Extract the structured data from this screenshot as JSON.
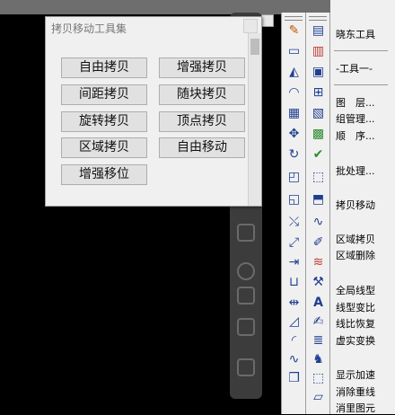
{
  "panel": {
    "title": "拷贝移动工具集",
    "buttons": [
      {
        "label": "自由拷贝"
      },
      {
        "label": "增强拷贝"
      },
      {
        "label": "间距拷贝"
      },
      {
        "label": "随块拷贝"
      },
      {
        "label": "旋转拷贝"
      },
      {
        "label": "顶点拷贝"
      },
      {
        "label": "区域拷贝"
      },
      {
        "label": "自由移动"
      },
      {
        "label": "增强移位"
      }
    ]
  },
  "menu": {
    "items": [
      {
        "label": "晓东工具"
      },
      {
        "label": "-工具一-"
      },
      {
        "label": "图　层..."
      },
      {
        "label": "组管理..."
      },
      {
        "label": "顺　序..."
      },
      {
        "label": "批处理..."
      },
      {
        "label": "拷贝移动"
      },
      {
        "label": "区域拷贝"
      },
      {
        "label": "区域删除"
      },
      {
        "label": "全局线型"
      },
      {
        "label": "线型变比"
      },
      {
        "label": "线比恢复"
      },
      {
        "label": "虚实变换"
      },
      {
        "label": "显示加速"
      },
      {
        "label": "消除重线"
      },
      {
        "label": "消里图元"
      }
    ]
  },
  "toolbar1": {
    "icons": [
      "brush-icon",
      "rectangle-icon",
      "mirror-icon",
      "offset-icon",
      "array-icon",
      "move-icon",
      "rotate-icon",
      "scale-icon",
      "stretch-icon",
      "trim-icon",
      "extend-icon",
      "break-icon",
      "join-icon",
      "chamfer-icon",
      "fillet-icon",
      "explode-icon",
      "copy-icon"
    ]
  },
  "toolbar2": {
    "icons": [
      "layer-icon",
      "layer-props-icon",
      "block-icon",
      "grid-icon",
      "table-icon",
      "image-icon",
      "check-icon",
      "select-icon",
      "select2-icon",
      "curve-icon",
      "edit-icon",
      "color-icon",
      "tool-icon",
      "text-icon",
      "note-icon",
      "style-icon",
      "figure-icon",
      "select3-icon",
      "eraser-icon"
    ]
  },
  "colors": {
    "accent": "#1f3f8f",
    "panel_bg": "#f0f0f0",
    "button_bg": "#e1e1e1"
  }
}
